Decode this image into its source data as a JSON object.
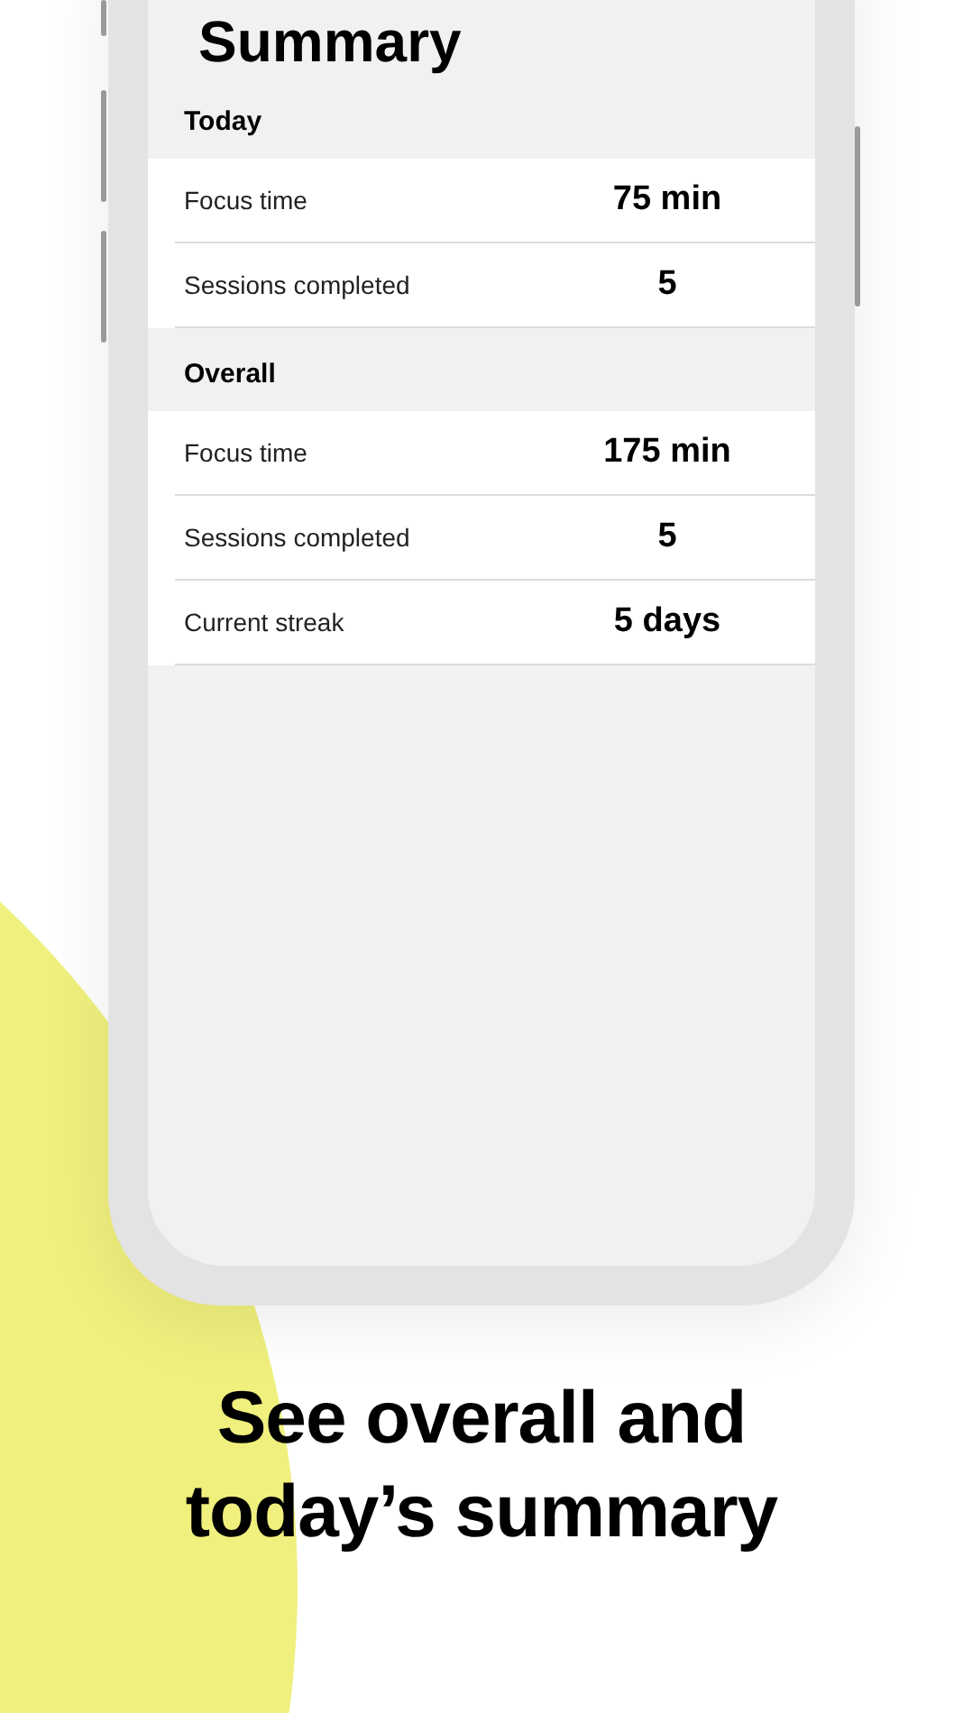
{
  "screen": {
    "title": "Summary",
    "sections": [
      {
        "heading": "Today",
        "rows": [
          {
            "label": "Focus time",
            "value": "75 min"
          },
          {
            "label": "Sessions completed",
            "value": "5"
          }
        ]
      },
      {
        "heading": "Overall",
        "rows": [
          {
            "label": "Focus time",
            "value": "175 min"
          },
          {
            "label": "Sessions completed",
            "value": "5"
          },
          {
            "label": "Current streak",
            "value": "5 days"
          }
        ]
      }
    ]
  },
  "caption": "See overall and today’s summary"
}
